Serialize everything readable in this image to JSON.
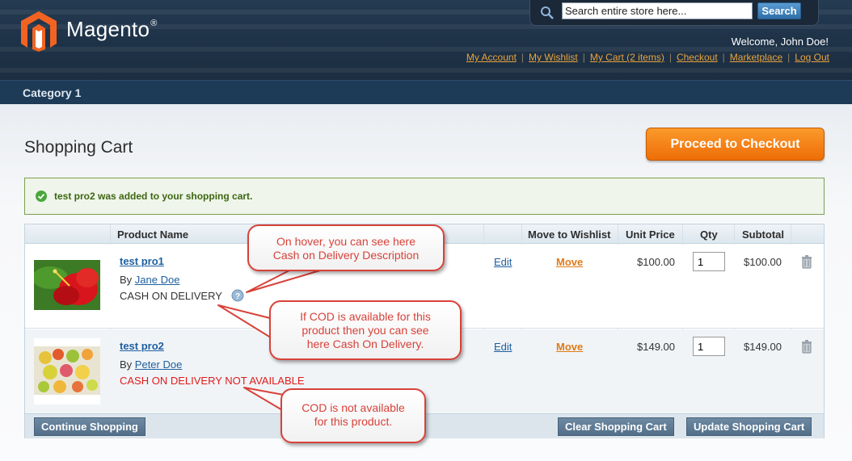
{
  "header": {
    "logo_text": "Magento",
    "logo_mark": "®",
    "search_placeholder": "Search entire store here...",
    "search_value": "Search entire store here...",
    "search_button": "Search",
    "welcome": "Welcome, John Doe!",
    "links": [
      "My Account",
      "My Wishlist",
      "My Cart (2 items)",
      "Checkout",
      "Marketplace",
      "Log Out"
    ]
  },
  "nav": {
    "category": "Category 1"
  },
  "page": {
    "title": "Shopping Cart",
    "checkout_button": "Proceed to Checkout",
    "success_message": "test pro2 was added to your shopping cart."
  },
  "table": {
    "headers": [
      "Product Name",
      "Move to Wishlist",
      "Unit Price",
      "Qty",
      "Subtotal"
    ],
    "rows": [
      {
        "name": "test pro1",
        "by_label": "By",
        "seller": "Jane Doe",
        "cod": "CASH ON DELIVERY",
        "edit": "Edit",
        "move": "Move",
        "unit_price": "$100.00",
        "qty": "1",
        "subtotal": "$100.00"
      },
      {
        "name": "test pro2",
        "by_label": "By",
        "seller": "Peter Doe",
        "cod": "CASH ON DELIVERY NOT AVAILABLE",
        "edit": "Edit",
        "move": "Move",
        "unit_price": "$149.00",
        "qty": "1",
        "subtotal": "$149.00"
      }
    ],
    "continue_button": "Continue Shopping",
    "clear_button": "Clear Shopping Cart",
    "update_button": "Update Shopping Cart"
  },
  "callouts": {
    "hover": [
      "On hover, you can see here",
      "Cash on Delivery Description"
    ],
    "available": [
      "If COD is available for this",
      "product then you can see",
      "here Cash On Delivery."
    ],
    "not_available": [
      "COD is not available",
      "for this product."
    ]
  },
  "colors": {
    "accent": "#ee6d07",
    "link": "#1e5fa0",
    "callout": "#d8423a",
    "cod_unavailable": "#e01b1b"
  }
}
